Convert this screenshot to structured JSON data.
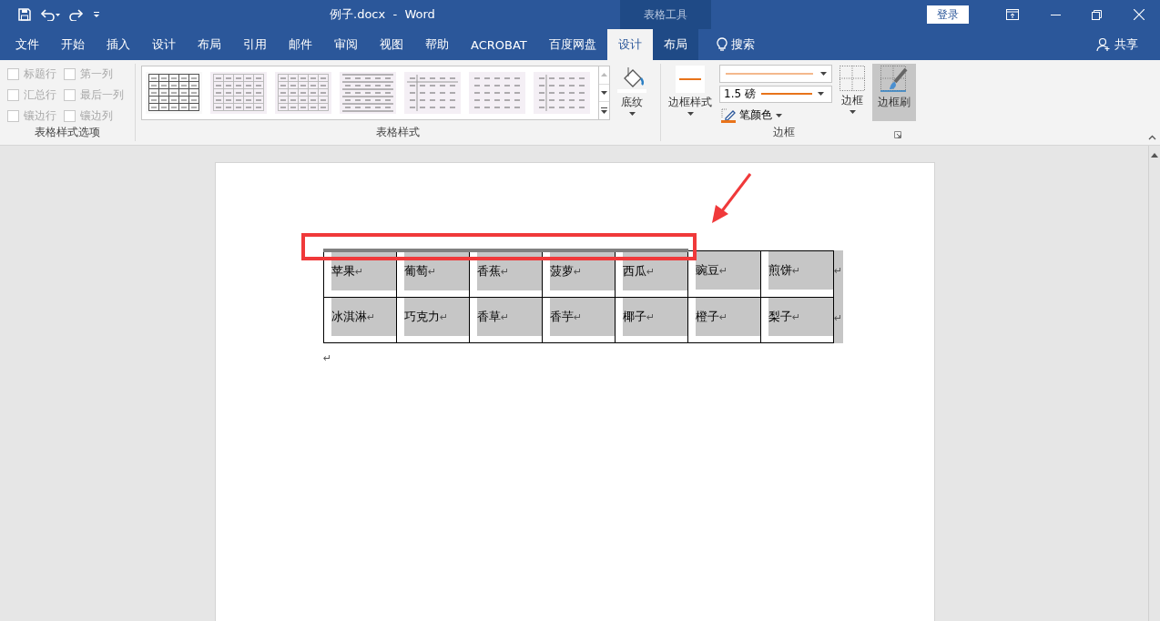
{
  "title_bar": {
    "document_title": "例子.docx  -  Word",
    "contextual_label": "表格工具",
    "sign_in": "登录"
  },
  "tabs": [
    {
      "label": "文件",
      "selected": false,
      "contextual": false
    },
    {
      "label": "开始",
      "selected": false,
      "contextual": false
    },
    {
      "label": "插入",
      "selected": false,
      "contextual": false
    },
    {
      "label": "设计",
      "selected": false,
      "contextual": false
    },
    {
      "label": "布局",
      "selected": false,
      "contextual": false
    },
    {
      "label": "引用",
      "selected": false,
      "contextual": false
    },
    {
      "label": "邮件",
      "selected": false,
      "contextual": false
    },
    {
      "label": "审阅",
      "selected": false,
      "contextual": false
    },
    {
      "label": "视图",
      "selected": false,
      "contextual": false
    },
    {
      "label": "帮助",
      "selected": false,
      "contextual": false
    },
    {
      "label": "ACROBAT",
      "selected": false,
      "contextual": false
    },
    {
      "label": "百度网盘",
      "selected": false,
      "contextual": false
    },
    {
      "label": "设计",
      "selected": true,
      "contextual": true
    },
    {
      "label": "布局",
      "selected": false,
      "contextual": true
    }
  ],
  "search": {
    "label": "搜索"
  },
  "share": {
    "label": "共享"
  },
  "ribbon": {
    "style_options": {
      "title": "表格样式选项",
      "items": [
        {
          "label": "标题行",
          "checked": false,
          "disabled": true
        },
        {
          "label": "第一列",
          "checked": false,
          "disabled": true
        },
        {
          "label": "汇总行",
          "checked": false,
          "disabled": true
        },
        {
          "label": "最后一列",
          "checked": false,
          "disabled": true
        },
        {
          "label": "镶边行",
          "checked": false,
          "disabled": true
        },
        {
          "label": "镶边列",
          "checked": false,
          "disabled": true
        }
      ]
    },
    "table_styles": {
      "title": "表格样式",
      "thumbnails": [
        {
          "kind": "grid"
        },
        {
          "kind": "light-grid"
        },
        {
          "kind": "light-grid"
        },
        {
          "kind": "lines"
        },
        {
          "kind": "header-lines"
        },
        {
          "kind": "plain"
        },
        {
          "kind": "first-col"
        }
      ],
      "shading": "底纹"
    },
    "borders": {
      "title": "边框",
      "border_styles": "边框样式",
      "line_weight": "1.5 磅",
      "pen_color": "笔颜色",
      "borders_button": "边框",
      "border_painter": {
        "label": "边框刷",
        "selected": true
      }
    }
  },
  "document": {
    "rows": [
      {
        "cells": [
          {
            "text": "苹果",
            "mark": "↵",
            "thick_top_border": true
          },
          {
            "text": "葡萄",
            "mark": "↵",
            "thick_top_border": true
          },
          {
            "text": "香蕉",
            "mark": "↵",
            "thick_top_border": true
          },
          {
            "text": "菠萝",
            "mark": "↵",
            "thick_top_border": true
          },
          {
            "text": "西瓜",
            "mark": "↵",
            "thick_top_border": true
          },
          {
            "text": "豌豆",
            "mark": "↵",
            "thick_top_border": false
          },
          {
            "text": "煎饼",
            "mark": "↵",
            "thick_top_border": false
          }
        ],
        "end_mark": "↵"
      },
      {
        "cells": [
          {
            "text": "冰淇淋",
            "mark": "↵",
            "thick_top_border": false
          },
          {
            "text": "巧克力",
            "mark": "↵",
            "thick_top_border": false
          },
          {
            "text": "香草",
            "mark": "↵",
            "thick_top_border": false
          },
          {
            "text": "香芋",
            "mark": "↵",
            "thick_top_border": false
          },
          {
            "text": "椰子",
            "mark": "↵",
            "thick_top_border": false
          },
          {
            "text": "橙子",
            "mark": "↵",
            "thick_top_border": false
          },
          {
            "text": "梨子",
            "mark": "↵",
            "thick_top_border": false
          }
        ],
        "end_mark": "↵"
      }
    ],
    "after_mark": "↵"
  }
}
